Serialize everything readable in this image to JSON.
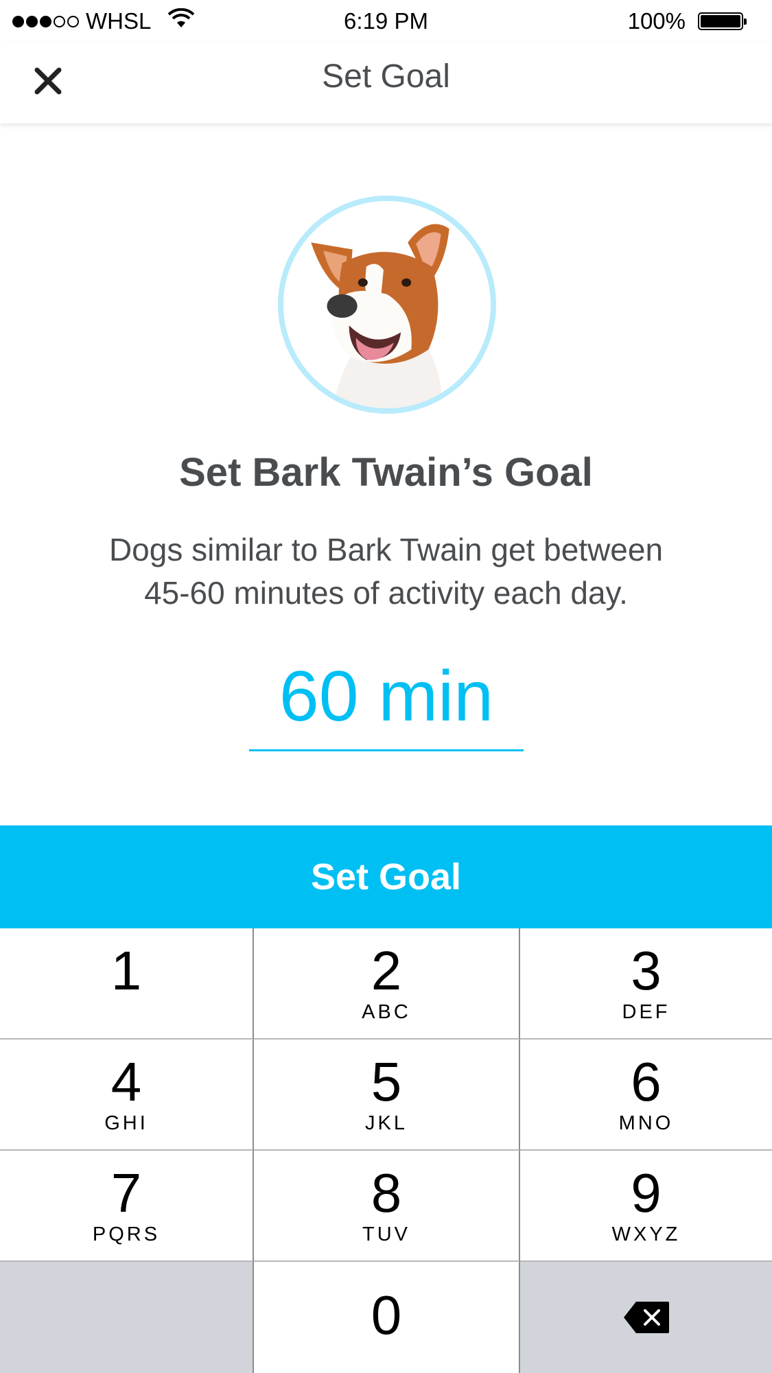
{
  "status_bar": {
    "carrier": "WHSL",
    "signal_bars_filled": 3,
    "signal_bars_total": 5,
    "time": "6:19 PM",
    "battery": "100%",
    "battery_level": 1.0
  },
  "nav": {
    "title": "Set Goal",
    "close_icon": "close-icon"
  },
  "avatar": {
    "ring_color": "#b8ebfb"
  },
  "heading": "Set Bark Twain’s Goal",
  "description": "Dogs similar to Bark Twain get between\n45-60  minutes of activity each day.",
  "goal_input": {
    "value": "60  min",
    "color": "#00bff3"
  },
  "set_goal_button": {
    "label": "Set Goal",
    "color": "#00bff3"
  },
  "keypad": {
    "keys": [
      {
        "digit": "1",
        "letters": ""
      },
      {
        "digit": "2",
        "letters": "ABC"
      },
      {
        "digit": "3",
        "letters": "DEF"
      },
      {
        "digit": "4",
        "letters": "GHI"
      },
      {
        "digit": "5",
        "letters": "JKL"
      },
      {
        "digit": "6",
        "letters": "MNO"
      },
      {
        "digit": "7",
        "letters": "PQRS"
      },
      {
        "digit": "8",
        "letters": "TUV"
      },
      {
        "digit": "9",
        "letters": "WXYZ"
      },
      {
        "digit": "0",
        "letters": ""
      }
    ],
    "backspace_icon": "backspace-icon"
  }
}
